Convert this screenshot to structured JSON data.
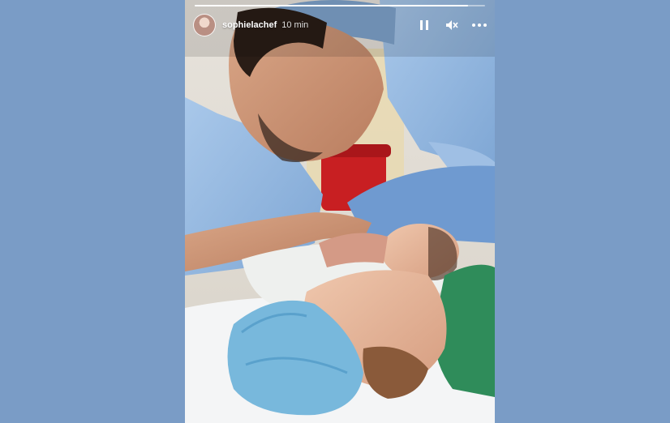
{
  "page": {
    "background": "#7a9cc6"
  },
  "story": {
    "username": "sophielachef",
    "time_ago": "10 min",
    "progress": 0.94,
    "icons": {
      "avatar": "avatar-image",
      "pause": "pause-icon",
      "mute": "speaker-muted-icon",
      "more": "more-options-icon"
    }
  }
}
